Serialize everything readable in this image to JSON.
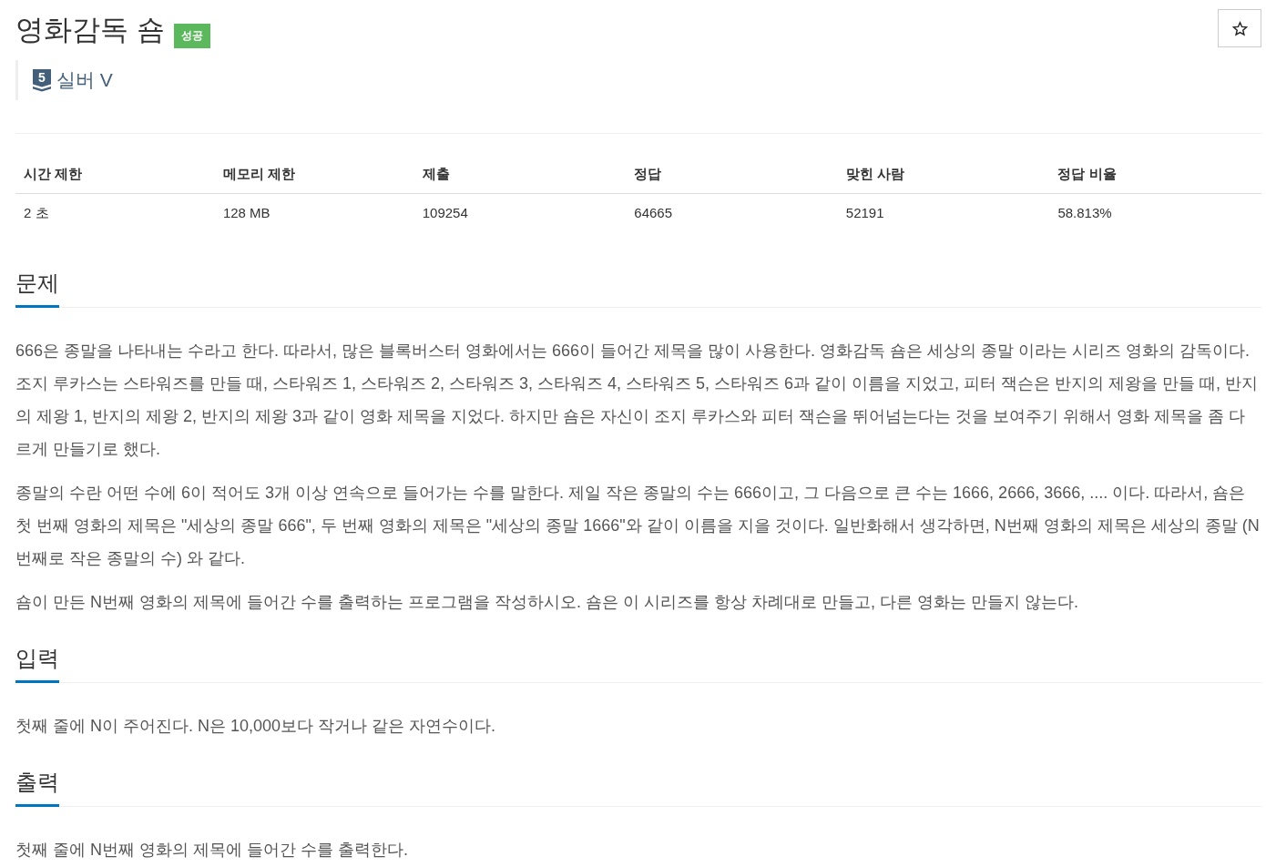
{
  "title": "영화감독 숌",
  "status_badge": "성공",
  "favorite": {
    "starred": false
  },
  "tier": {
    "number": "5",
    "name": "실버 V"
  },
  "stats": {
    "columns": [
      "시간 제한",
      "메모리 제한",
      "제출",
      "정답",
      "맞힌 사람",
      "정답 비율"
    ],
    "rows": [
      [
        "2 초",
        "128 MB",
        "109254",
        "64665",
        "52191",
        "58.813%"
      ]
    ]
  },
  "sections": [
    {
      "heading": "문제",
      "paragraphs": [
        "666은 종말을 나타내는 수라고 한다. 따라서, 많은 블록버스터 영화에서는 666이 들어간 제목을 많이 사용한다. 영화감독 숌은 세상의 종말 이라는 시리즈 영화의 감독이다. 조지 루카스는 스타워즈를 만들 때, 스타워즈 1, 스타워즈 2, 스타워즈 3, 스타워즈 4, 스타워즈 5, 스타워즈 6과 같이 이름을 지었고, 피터 잭슨은 반지의 제왕을 만들 때, 반지의 제왕 1, 반지의 제왕 2, 반지의 제왕 3과 같이 영화 제목을 지었다. 하지만 숌은 자신이 조지 루카스와 피터 잭슨을 뛰어넘는다는 것을 보여주기 위해서 영화 제목을 좀 다르게 만들기로 했다.",
        "종말의 수란 어떤 수에 6이 적어도 3개 이상 연속으로 들어가는 수를 말한다. 제일 작은 종말의 수는 666이고, 그 다음으로 큰 수는 1666, 2666, 3666, .... 이다. 따라서, 숌은 첫 번째 영화의 제목은 \"세상의 종말 666\", 두 번째 영화의 제목은 \"세상의 종말 1666\"와 같이 이름을 지을 것이다. 일반화해서 생각하면, N번째 영화의 제목은 세상의 종말 (N번째로 작은 종말의 수) 와 같다.",
        "숌이 만든 N번째 영화의 제목에 들어간 수를 출력하는 프로그램을 작성하시오. 숌은 이 시리즈를 항상 차례대로 만들고, 다른 영화는 만들지 않는다."
      ]
    },
    {
      "heading": "입력",
      "paragraphs": [
        "첫째 줄에 N이 주어진다. N은 10,000보다 작거나 같은 자연수이다."
      ]
    },
    {
      "heading": "출력",
      "paragraphs": [
        "첫째 줄에 N번째 영화의 제목에 들어간 수를 출력한다."
      ]
    }
  ]
}
